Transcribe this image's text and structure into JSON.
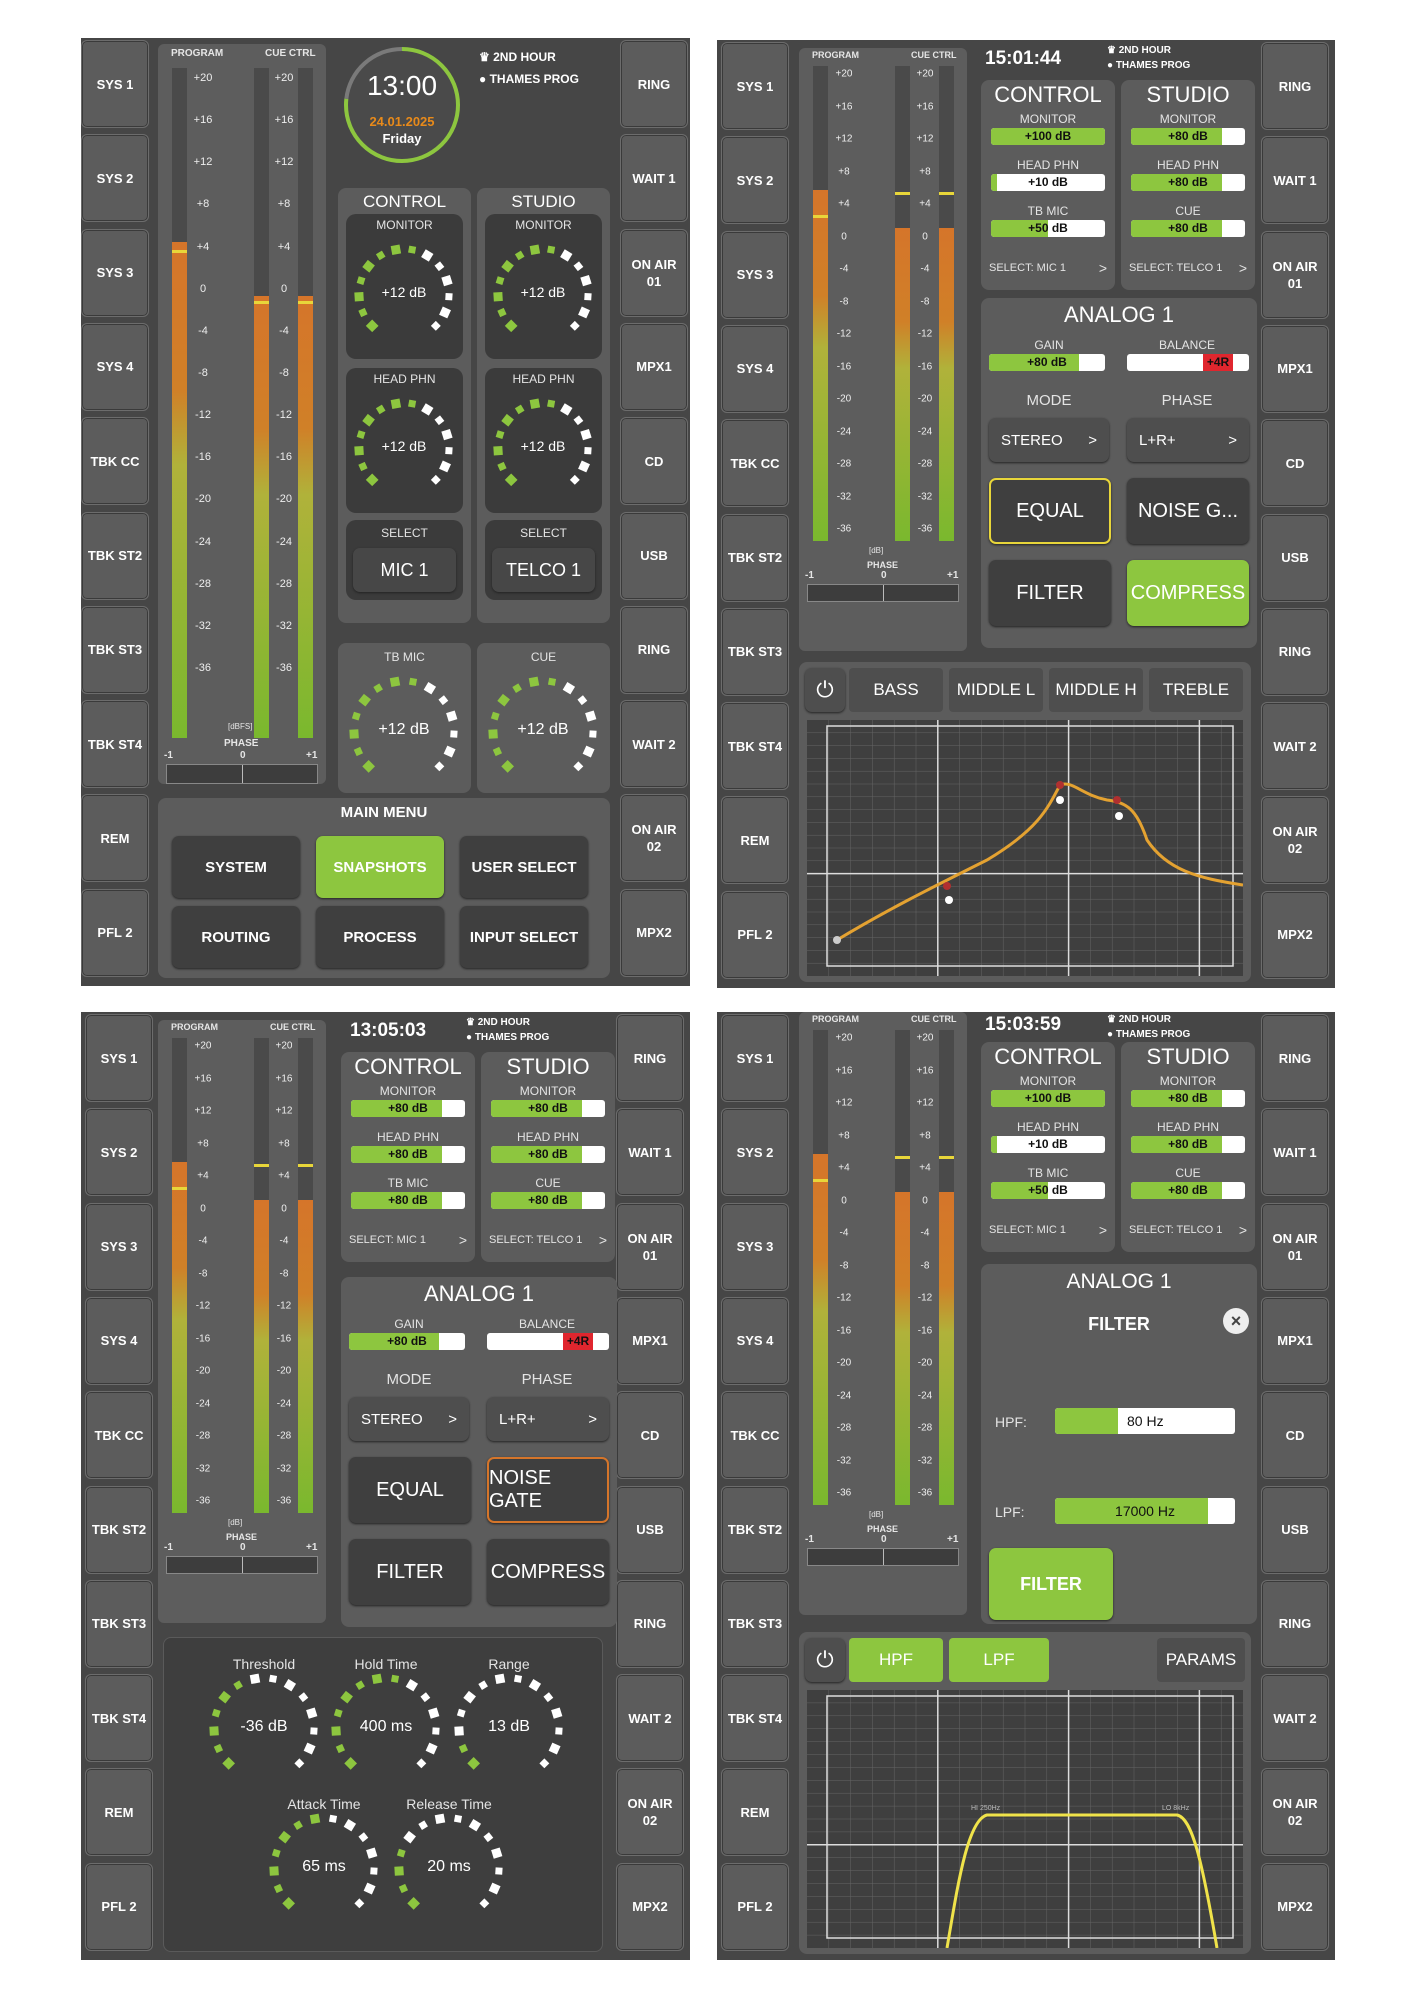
{
  "sidebar_left_p1": [
    "SYS 1",
    "SYS 2",
    "SYS 3",
    "SYS 4",
    "TBK CC",
    "TBK ST2",
    "TBK ST3",
    "TBK ST4",
    "REM",
    "PFL 2"
  ],
  "sidebar_right_p1": [
    "RING",
    "WAIT 1",
    "ON AIR\n01",
    "MPX1",
    "CD",
    "USB",
    "RING",
    "WAIT 2",
    "ON AIR\n02",
    "MPX2"
  ],
  "meters": {
    "program_label": "PROGRAM",
    "cue_label": "CUE CTRL",
    "unit_dbfs": "[dBFS]",
    "unit_db": "[dB]",
    "phase_label": "PHASE",
    "phase_min": "-1",
    "phase_mid": "0",
    "phase_max": "+1",
    "scale": [
      "+20",
      "+16",
      "+12",
      "+8",
      "+4",
      "0",
      "-4",
      "-8",
      "-12",
      "-16",
      "-20",
      "-24",
      "-28",
      "-32",
      "-36"
    ],
    "program_level": 0.74,
    "cue_level": 0.66
  },
  "header": {
    "show": "2ND HOUR",
    "user": "THAMES PROG"
  },
  "p1": {
    "clock": "13:00",
    "date": "24.01.2025",
    "day": "Friday",
    "control_title": "CONTROL",
    "studio_title": "STUDIO",
    "monitor": "MONITOR",
    "head_phn": "HEAD PHN",
    "select": "SELECT",
    "knob_value": "+12 dB",
    "knob_level": 0.55,
    "control_select": "MIC 1",
    "studio_select": "TELCO 1",
    "tb_mic": "TB MIC",
    "cue": "CUE",
    "menu_title": "MAIN MENU",
    "menu": [
      "SYSTEM",
      "SNAPSHOTS",
      "USER SELECT",
      "ROUTING",
      "PROCESS",
      "INPUT SELECT"
    ]
  },
  "p2": {
    "clock": "15:01:44",
    "control": {
      "title": "CONTROL",
      "monitor_label": "MONITOR",
      "monitor": "+100 dB",
      "monitor_level": 1.0,
      "phn_label": "HEAD PHN",
      "phn": "+10 dB",
      "phn_level": 0.05,
      "tb_label": "TB MIC",
      "tb": "+50 dB",
      "tb_level": 0.5,
      "select": "SELECT:  MIC 1",
      "arrow": ">"
    },
    "studio": {
      "title": "STUDIO",
      "monitor_label": "MONITOR",
      "monitor": "+80 dB",
      "monitor_level": 0.8,
      "phn_label": "HEAD PHN",
      "phn": "+80 dB",
      "phn_level": 0.8,
      "cue_label": "CUE",
      "cue": "+80 dB",
      "cue_level": 0.8,
      "select": "SELECT:  TELCO 1",
      "arrow": ">"
    },
    "analog": {
      "title": "ANALOG 1",
      "gain_label": "GAIN",
      "gain": "+80 dB",
      "gain_level": 0.8,
      "balance_label": "BALANCE",
      "balance": "+4R",
      "mode_label": "MODE",
      "mode": "STEREO",
      "phase_label": "PHASE",
      "phase": "L+R+",
      "arrow": ">"
    },
    "buttons": [
      "EQUAL",
      "NOISE G...",
      "FILTER",
      "COMPRESS"
    ],
    "eq_tabs": [
      "BASS",
      "MIDDLE L",
      "MIDDLE H",
      "TREBLE"
    ]
  },
  "p3": {
    "clock": "13:05:03",
    "control": {
      "title": "CONTROL",
      "monitor_label": "MONITOR",
      "monitor": "+80 dB",
      "phn_label": "HEAD PHN",
      "phn": "+80 dB",
      "tb_label": "TB MIC",
      "tb": "+80 dB",
      "select": "SELECT:  MIC 1",
      "arrow": ">"
    },
    "studio": {
      "title": "STUDIO",
      "monitor_label": "MONITOR",
      "monitor": "+80 dB",
      "phn_label": "HEAD PHN",
      "phn": "+80 dB",
      "cue_label": "CUE",
      "cue": "+80 dB",
      "select": "SELECT:  TELCO 1",
      "arrow": ">"
    },
    "analog": {
      "title": "ANALOG 1",
      "gain_label": "GAIN",
      "gain": "+80 dB",
      "balance_label": "BALANCE",
      "balance": "+4R",
      "mode_label": "MODE",
      "mode": "STEREO",
      "phase_label": "PHASE",
      "phase": "L+R+",
      "arrow": ">"
    },
    "buttons": [
      "EQUAL",
      "NOISE GATE",
      "FILTER",
      "COMPRESS"
    ],
    "gate": [
      {
        "label": "Threshold",
        "value": "-36 dB",
        "level": 0.45
      },
      {
        "label": "Hold Time",
        "value": "400 ms",
        "level": 0.55
      },
      {
        "label": "Range",
        "value": "13 dB",
        "level": 0.15
      },
      {
        "label": "Attack Time",
        "value": "65 ms",
        "level": 0.5
      },
      {
        "label": "Release Time",
        "value": "20 ms",
        "level": 0.25
      }
    ]
  },
  "p4": {
    "clock": "15:03:59",
    "analog_title": "ANALOG 1",
    "filter_title": "FILTER",
    "hpf_label": "HPF:",
    "hpf": "80 Hz",
    "hpf_level": 0.35,
    "lpf_label": "LPF:",
    "lpf": "17000 Hz",
    "lpf_level": 0.85,
    "filter_button": "FILTER",
    "tabs": [
      "HPF",
      "LPF",
      "PARAMS"
    ],
    "graph_hpf_marker": "HI 250Hz",
    "graph_lpf_marker": "LO 8kHz"
  }
}
